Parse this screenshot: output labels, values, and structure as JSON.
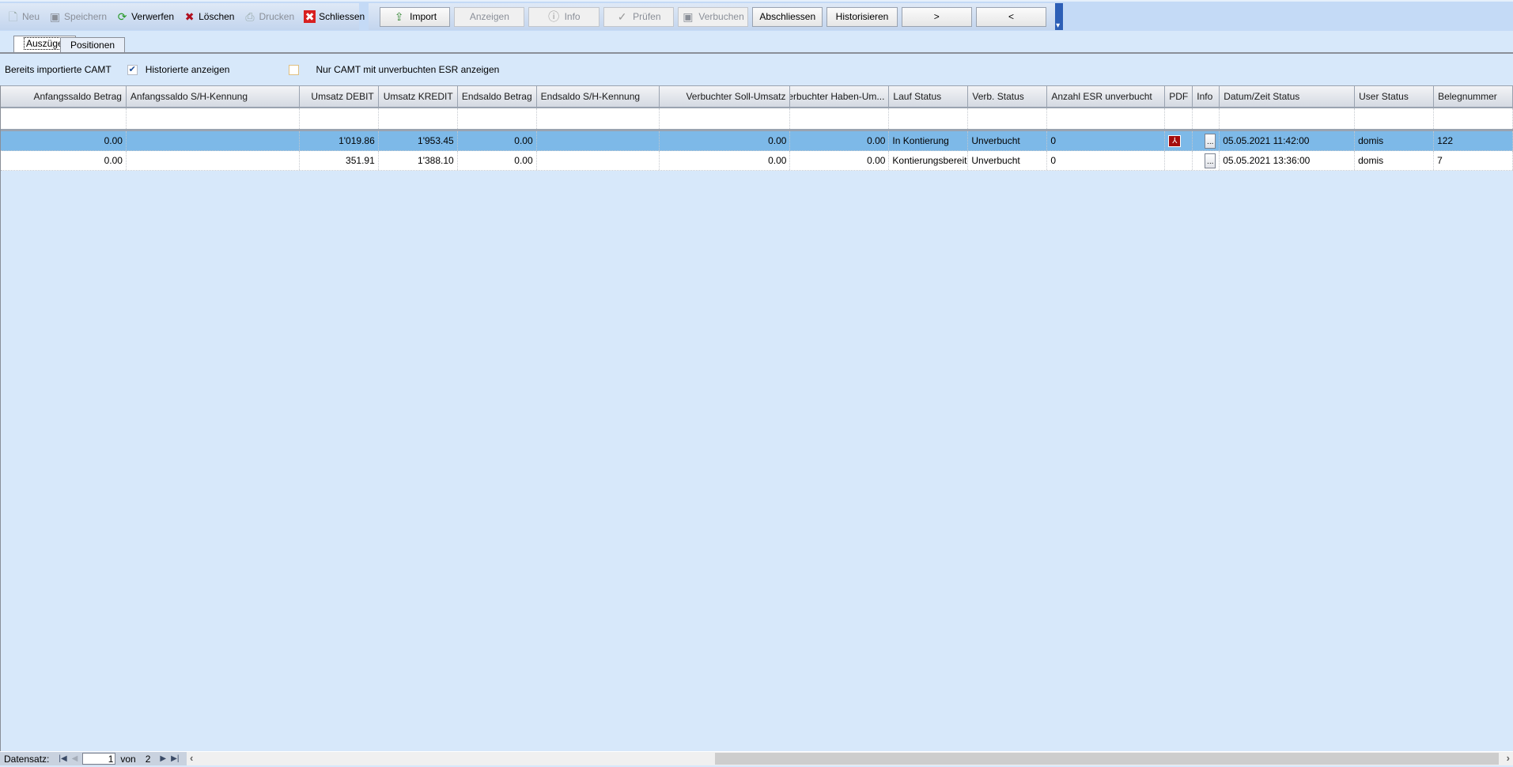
{
  "toolbar_left": [
    {
      "label": "Neu",
      "icon": "new-document-icon",
      "enabled": false
    },
    {
      "label": "Speichern",
      "icon": "save-icon",
      "enabled": false
    },
    {
      "label": "Verwerfen",
      "icon": "discard-refresh-icon",
      "enabled": true
    },
    {
      "label": "Löschen",
      "icon": "delete-x-icon",
      "enabled": true
    },
    {
      "label": "Drucken",
      "icon": "printer-icon",
      "enabled": false
    },
    {
      "label": "Schliessen",
      "icon": "close-icon",
      "enabled": true
    }
  ],
  "toolbar_right": [
    {
      "label": "Import",
      "icon": "import-icon",
      "enabled": true
    },
    {
      "label": "Anzeigen",
      "enabled": false
    },
    {
      "label": "Info",
      "icon": "info-icon",
      "enabled": false
    },
    {
      "label": "Prüfen",
      "icon": "check-icon",
      "enabled": false
    },
    {
      "label": "Verbuchen",
      "icon": "save-icon",
      "enabled": false
    },
    {
      "label": "Abschliessen",
      "enabled": true
    },
    {
      "label": "Historisieren",
      "enabled": true
    },
    {
      "label": ">",
      "enabled": true
    },
    {
      "label": "<",
      "enabled": true
    }
  ],
  "tabs": [
    {
      "label": "Auszüge",
      "active": true
    },
    {
      "label": "Positionen",
      "active": false
    }
  ],
  "filters": {
    "title": "Bereits importierte CAMT",
    "show_historized": {
      "label": "Historierte anzeigen",
      "checked": true
    },
    "only_unbooked_esr": {
      "label": "Nur CAMT mit unverbuchten ESR anzeigen",
      "checked": false
    }
  },
  "grid": {
    "columns": [
      "Anfangssaldo Betrag",
      "Anfangssaldo S/H-Kennung",
      "Umsatz DEBIT",
      "Umsatz KREDIT",
      "Endsaldo Betrag",
      "Endsaldo S/H-Kennung",
      "Verbuchter Soll-Umsatz",
      "Verbuchter Haben-Um...",
      "Lauf Status",
      "Verb. Status",
      "Anzahl ESR unverbucht",
      "PDF",
      "Info",
      "Datum/Zeit Status",
      "User Status",
      "Belegnummer"
    ],
    "rows": [
      {
        "selected": true,
        "cells": [
          "0.00",
          "",
          "1'019.86",
          "1'953.45",
          "0.00",
          "",
          "0.00",
          "0.00",
          "In Kontierung",
          "Unverbucht",
          "0",
          "pdf",
          "...",
          "05.05.2021 11:42:00",
          "domis",
          "122"
        ]
      },
      {
        "selected": false,
        "cells": [
          "0.00",
          "",
          "351.91",
          "1'388.10",
          "0.00",
          "",
          "0.00",
          "0.00",
          "Kontierungsbereit",
          "Unverbucht",
          "0",
          "",
          "...",
          "05.05.2021 13:36:00",
          "domis",
          "7"
        ]
      }
    ]
  },
  "footer": {
    "label": "Datensatz:",
    "current": "1",
    "of_label": "von",
    "total": "2"
  },
  "colors": {
    "selected_row": "#7db9e8",
    "background": "#d7e8fa",
    "toolbar": "#c4daf6"
  }
}
